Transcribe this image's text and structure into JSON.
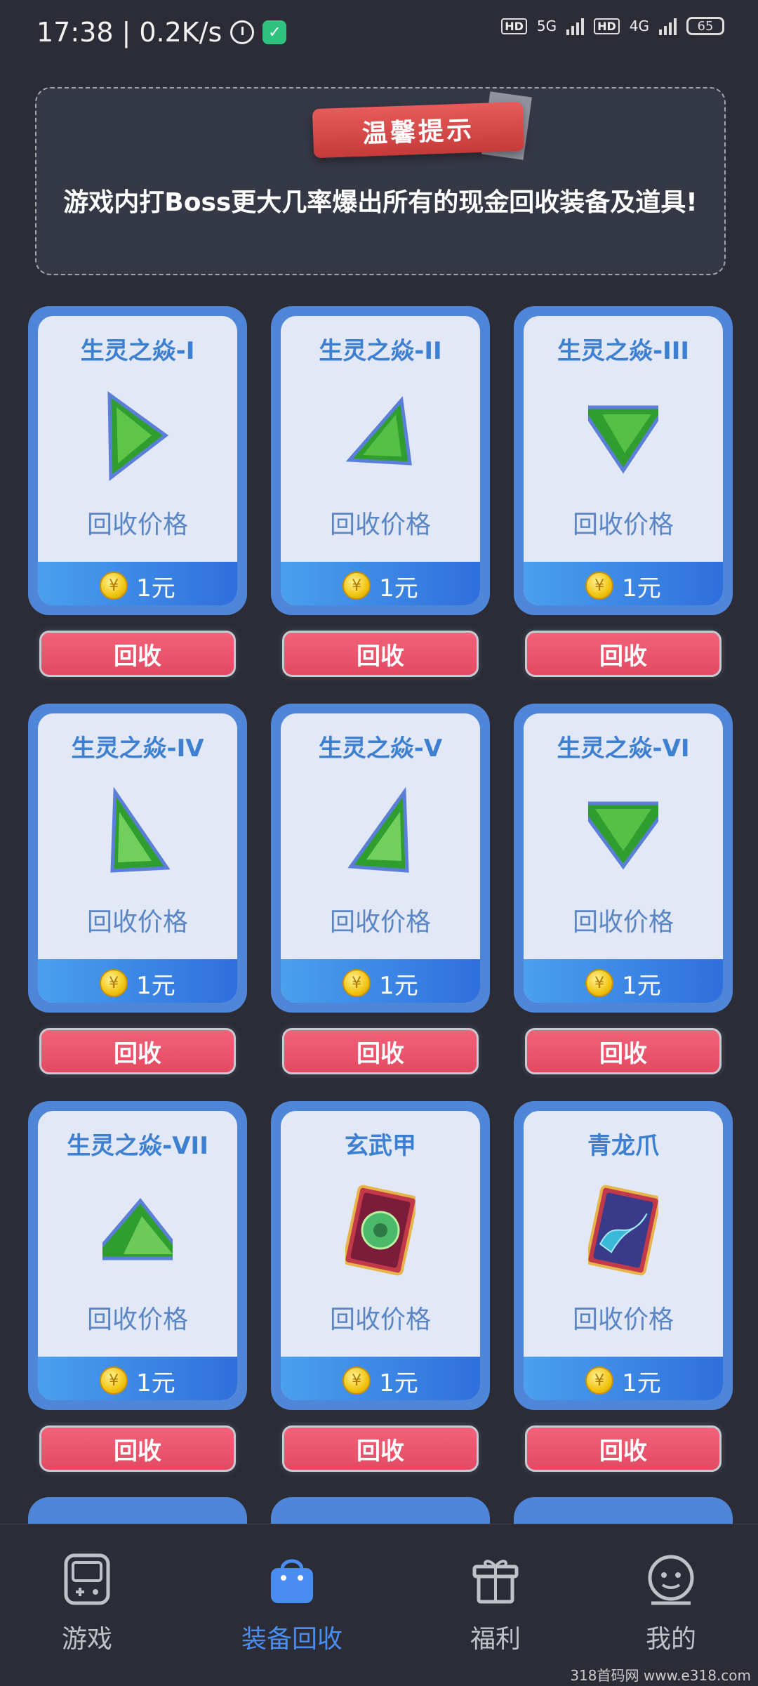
{
  "status_bar": {
    "time": "17:38",
    "network_speed": "0.2K/s",
    "separator": "|",
    "hd1": "HD",
    "net1": "5G",
    "hd2": "HD",
    "net2": "4G",
    "battery": "65"
  },
  "notice": {
    "ribbon": "温馨提示",
    "text": "游戏内打Boss更大几率爆出所有的现金回收装备及道具!"
  },
  "items": [
    {
      "title": "生灵之焱-I",
      "label": "回收价格",
      "price": "1元",
      "button": "回收"
    },
    {
      "title": "生灵之焱-II",
      "label": "回收价格",
      "price": "1元",
      "button": "回收"
    },
    {
      "title": "生灵之焱-III",
      "label": "回收价格",
      "price": "1元",
      "button": "回收"
    },
    {
      "title": "生灵之焱-IV",
      "label": "回收价格",
      "price": "1元",
      "button": "回收"
    },
    {
      "title": "生灵之焱-V",
      "label": "回收价格",
      "price": "1元",
      "button": "回收"
    },
    {
      "title": "生灵之焱-VI",
      "label": "回收价格",
      "price": "1元",
      "button": "回收"
    },
    {
      "title": "生灵之焱-VII",
      "label": "回收价格",
      "price": "1元",
      "button": "回收"
    },
    {
      "title": "玄武甲",
      "label": "回收价格",
      "price": "1元",
      "button": "回收"
    },
    {
      "title": "青龙爪",
      "label": "回收价格",
      "price": "1元",
      "button": "回收"
    }
  ],
  "bottom_nav": [
    {
      "label": "游戏",
      "icon": "gamepad-icon"
    },
    {
      "label": "装备回收",
      "icon": "shopping-bag-icon",
      "active": true
    },
    {
      "label": "福利",
      "icon": "gift-icon"
    },
    {
      "label": "我的",
      "icon": "smiley-profile-icon"
    }
  ],
  "watermark": "318首码网 www.e318.com",
  "colors": {
    "background": "#2b2c36",
    "card_border": "#4f86d8",
    "accent": "#4a8df0",
    "button": "#e34a62"
  }
}
